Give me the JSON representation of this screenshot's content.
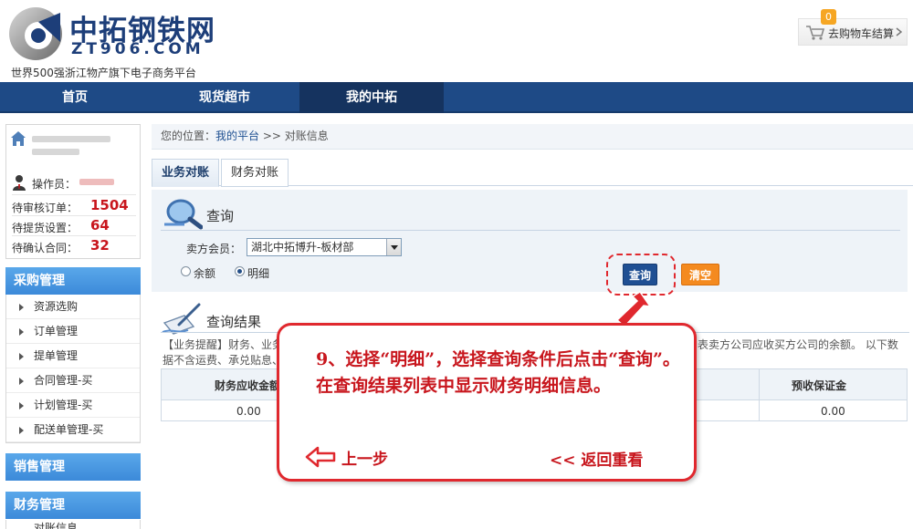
{
  "header": {
    "logo_cn": "中拓钢铁网",
    "logo_en": "ZT906.COM",
    "slogan": "世界500强浙江物产旗下电子商务平台",
    "cart_count": "0",
    "cart_label": "去购物车结算"
  },
  "nav": {
    "items": [
      {
        "label": "首页"
      },
      {
        "label": "现货超市"
      },
      {
        "label": "我的中拓",
        "active": true
      }
    ]
  },
  "user": {
    "operator_label": "操作员：",
    "stats": [
      {
        "label": "待审核订单：",
        "value": "1504"
      },
      {
        "label": "待提货设置：",
        "value": "64"
      },
      {
        "label": "待确认合同：",
        "value": "32"
      }
    ]
  },
  "sidebar": {
    "purchase_title": "采购管理",
    "purchase_items": [
      {
        "label": "资源选购"
      },
      {
        "label": "订单管理"
      },
      {
        "label": "提单管理"
      },
      {
        "label": "合同管理-买"
      },
      {
        "label": "计划管理-买"
      },
      {
        "label": "配送单管理-买"
      }
    ],
    "sales_title": "销售管理",
    "finance_title": "财务管理",
    "finance_first_item": "对账信息"
  },
  "breadcrumb": {
    "prefix": "您的位置：",
    "link": "我的平台",
    "separator": ">>",
    "current": "对账信息"
  },
  "tabs": [
    {
      "label": "业务对账",
      "active": true
    },
    {
      "label": "财务对账"
    }
  ],
  "query": {
    "title": "查询",
    "seller_label": "卖方会员：",
    "seller_value": "湖北中拓博升-板材部",
    "radio_balance": "余额",
    "radio_detail": "明细",
    "radio_selected": "明细",
    "query_button": "查询",
    "clear_button": "清空"
  },
  "results": {
    "title": "查询结果",
    "tip_part1": "【业务提醒】财务、业务",
    "tip_part2": "表卖方公司应收买方公司的余额。 以下数",
    "tip_part3": "据不含运费、承兑贴息、",
    "headers": [
      "财务应收金额",
      "预收保证金"
    ],
    "row": [
      "0.00",
      "0.00"
    ]
  },
  "callout": {
    "text": "9、选择“明细”，选择查询条件后点击“查询”。在查询结果列表中显示财务明细信息。",
    "prev": "上一步",
    "back": "<< 返回重看"
  },
  "colors": {
    "nav_bg": "#1e4a86",
    "side_head": "#4a9ae2",
    "stat_value": "#c8161d",
    "callout_red": "#e0282e",
    "query_btn": "#1f4f93",
    "clear_btn": "#f48a1f"
  }
}
